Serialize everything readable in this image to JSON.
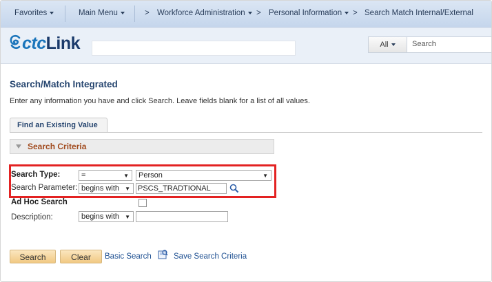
{
  "nav": {
    "favorites": "Favorites",
    "main_menu": "Main Menu",
    "breadcrumbs": [
      "Workforce Administration",
      "Personal Information",
      "Search Match Internal/External"
    ]
  },
  "header": {
    "logo_prefix": "ctc",
    "logo_suffix": "Link",
    "search_scope": "All",
    "search_placeholder": "Search"
  },
  "page": {
    "title": "Search/Match Integrated",
    "instructions": "Enter any information you have and click Search. Leave fields blank for a list of all values."
  },
  "tab": {
    "label": "Find an Existing Value"
  },
  "criteria": {
    "section_label": "Search Criteria",
    "search_type_label": "Search Type:",
    "search_type_operator": "=",
    "search_type_value": "Person",
    "search_param_label": "Search Parameter:",
    "search_param_operator": "begins with",
    "search_param_value": "PSCS_TRADTIONAL",
    "ad_hoc_label": "Ad Hoc Search",
    "ad_hoc_checked": false,
    "description_label": "Description:",
    "description_operator": "begins with",
    "description_value": ""
  },
  "actions": {
    "search": "Search",
    "clear": "Clear",
    "basic_search": "Basic Search",
    "save_criteria": "Save Search Criteria"
  },
  "colors": {
    "accent_blue": "#1d4f91",
    "section_title": "#a14b1e",
    "highlight_red": "#e32222",
    "button_fill": "#f1c983"
  }
}
